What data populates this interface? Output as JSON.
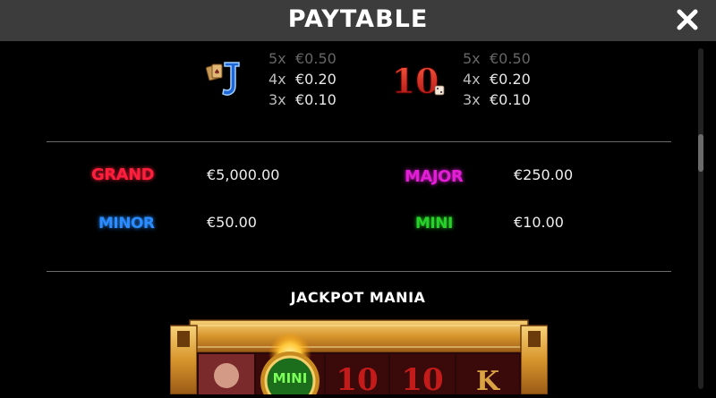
{
  "header": {
    "title": "PAYTABLE"
  },
  "icons": {
    "close": "close-icon"
  },
  "symbols": [
    {
      "name": "J",
      "icon": "card-j-icon",
      "payouts": [
        {
          "mult": "5x",
          "amount": "€0.50"
        },
        {
          "mult": "4x",
          "amount": "€0.20"
        },
        {
          "mult": "3x",
          "amount": "€0.10"
        }
      ]
    },
    {
      "name": "10",
      "icon": "card-10-icon",
      "payouts": [
        {
          "mult": "5x",
          "amount": "€0.50"
        },
        {
          "mult": "4x",
          "amount": "€0.20"
        },
        {
          "mult": "3x",
          "amount": "€0.10"
        }
      ]
    }
  ],
  "jackpots": [
    {
      "label": "GRAND",
      "value": "€5,000.00",
      "color": "#ff1f3d"
    },
    {
      "label": "MAJOR",
      "value": "€250.00",
      "color": "#e21fd6"
    },
    {
      "label": "MINOR",
      "value": "€50.00",
      "color": "#2a8cff"
    },
    {
      "label": "MINI",
      "value": "€10.00",
      "color": "#27d12a"
    }
  ],
  "section": {
    "title": "JACKPOT MANIA"
  },
  "machine_preview": {
    "mini_chip_label": "MINI",
    "reel_symbols": [
      "10",
      "10",
      "K"
    ]
  }
}
